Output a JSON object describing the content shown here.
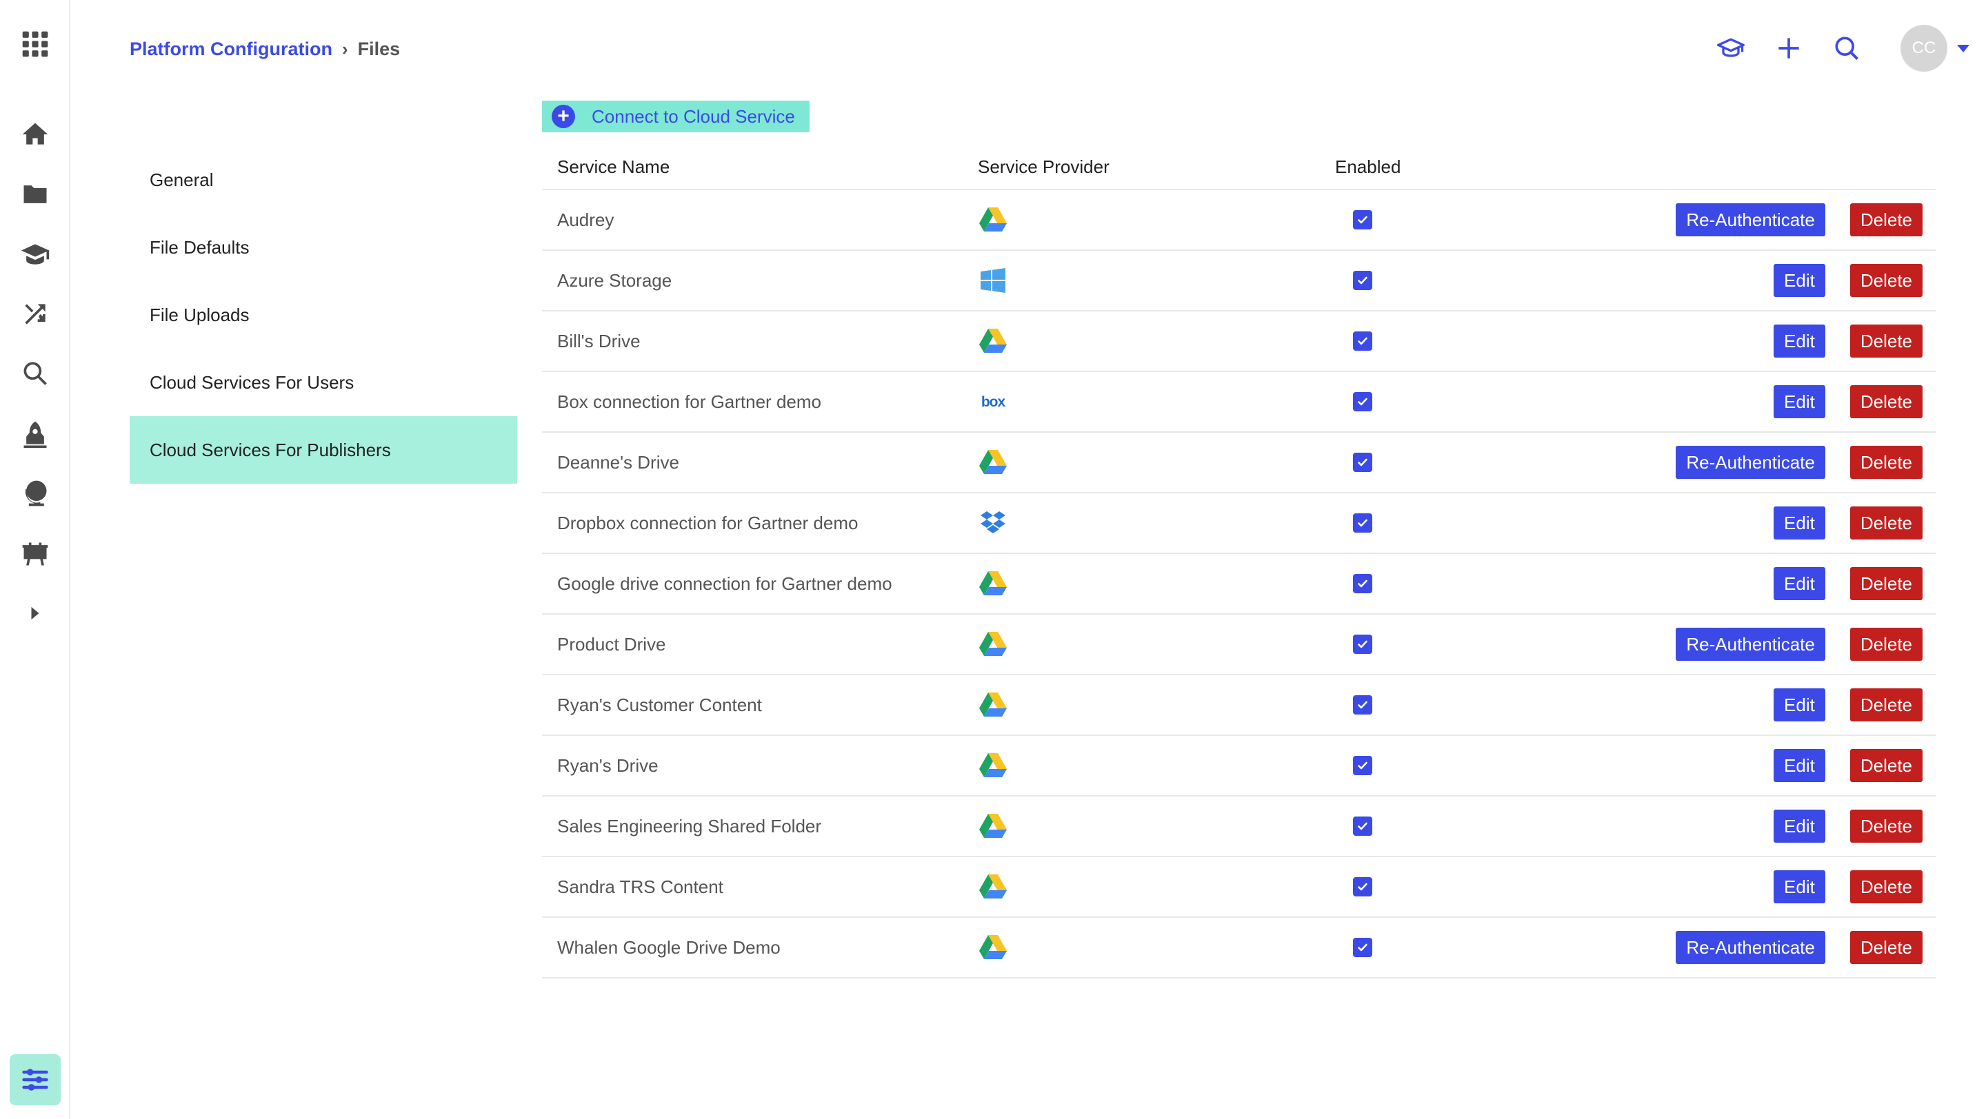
{
  "breadcrumb": {
    "parent": "Platform Configuration",
    "separator": "›",
    "current": "Files"
  },
  "user": {
    "initials": "CC"
  },
  "rail": [
    "apps-grid-icon",
    "home-icon",
    "folder-icon",
    "graduation-cap-icon",
    "shuffle-icon",
    "search-icon",
    "rocket-icon",
    "globe-icon",
    "presentation-icon",
    "expand-icon",
    "settings-sliders-icon"
  ],
  "subnav": [
    {
      "label": "General"
    },
    {
      "label": "File Defaults"
    },
    {
      "label": "File Uploads"
    },
    {
      "label": "Cloud Services For Users"
    },
    {
      "label": "Cloud Services For Publishers"
    }
  ],
  "connect_button": {
    "label": "Connect to Cloud Service",
    "icon": "plus-circle-icon"
  },
  "table": {
    "headers": {
      "name": "Service Name",
      "provider": "Service Provider",
      "enabled": "Enabled"
    },
    "rows": [
      {
        "name": "Audrey",
        "provider": "google-drive",
        "enabled": true,
        "primary_action": "Re-Authenticate",
        "delete": "Delete"
      },
      {
        "name": "Azure Storage",
        "provider": "azure",
        "enabled": true,
        "primary_action": "Edit",
        "delete": "Delete"
      },
      {
        "name": "Bill's Drive",
        "provider": "google-drive",
        "enabled": true,
        "primary_action": "Edit",
        "delete": "Delete"
      },
      {
        "name": "Box connection for Gartner demo",
        "provider": "box",
        "enabled": true,
        "primary_action": "Edit",
        "delete": "Delete"
      },
      {
        "name": "Deanne's Drive",
        "provider": "google-drive",
        "enabled": true,
        "primary_action": "Re-Authenticate",
        "delete": "Delete"
      },
      {
        "name": "Dropbox connection for Gartner demo",
        "provider": "dropbox",
        "enabled": true,
        "primary_action": "Edit",
        "delete": "Delete"
      },
      {
        "name": "Google drive connection for Gartner demo",
        "provider": "google-drive",
        "enabled": true,
        "primary_action": "Edit",
        "delete": "Delete"
      },
      {
        "name": "Product Drive",
        "provider": "google-drive",
        "enabled": true,
        "primary_action": "Re-Authenticate",
        "delete": "Delete"
      },
      {
        "name": "Ryan's Customer Content",
        "provider": "google-drive",
        "enabled": true,
        "primary_action": "Edit",
        "delete": "Delete"
      },
      {
        "name": "Ryan's Drive",
        "provider": "google-drive",
        "enabled": true,
        "primary_action": "Edit",
        "delete": "Delete"
      },
      {
        "name": "Sales Engineering Shared Folder",
        "provider": "google-drive",
        "enabled": true,
        "primary_action": "Edit",
        "delete": "Delete"
      },
      {
        "name": "Sandra TRS Content",
        "provider": "google-drive",
        "enabled": true,
        "primary_action": "Edit",
        "delete": "Delete"
      },
      {
        "name": "Whalen Google Drive Demo",
        "provider": "google-drive",
        "enabled": true,
        "primary_action": "Re-Authenticate",
        "delete": "Delete"
      }
    ]
  },
  "colors": {
    "accent": "#3b4ae6",
    "danger": "#c21f1f",
    "active_nav": "#a8f0de",
    "connect_bg": "#7ee8d4"
  }
}
